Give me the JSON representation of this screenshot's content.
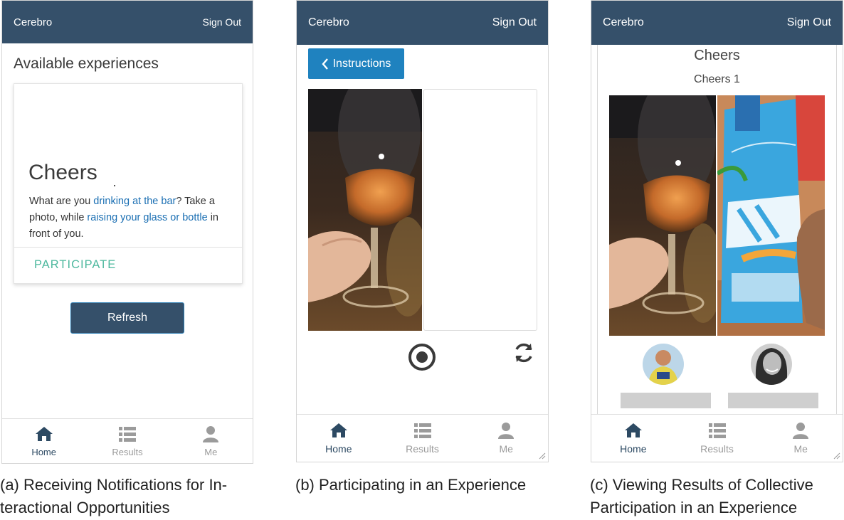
{
  "app": {
    "brand": "Cerebro",
    "sign_out": "Sign Out"
  },
  "panel_a": {
    "heading": "Available experiences",
    "card": {
      "title": "Cheers",
      "text_1": "What are you ",
      "link_1": "drinking at the bar",
      "text_2": "? Take a photo, while ",
      "link_2": "raising your glass or bottle",
      "text_3": " in front of you.",
      "action": "PARTICIPATE"
    },
    "refresh": "Refresh"
  },
  "panel_b": {
    "instructions": "Instructions"
  },
  "panel_c": {
    "title": "Cheers",
    "subtitle": "Cheers 1"
  },
  "tabs": {
    "home": "Home",
    "results": "Results",
    "me": "Me"
  },
  "captions": {
    "a": "(a) Receiving Notifications for In-teractional Opportunities",
    "b": "(b) Participating in an Experience",
    "c": "(c) Viewing Results of Collective Participation in an Experience"
  },
  "colors": {
    "topbar": "#35506a",
    "accent": "#1f82bf",
    "participate": "#4db89e",
    "link": "#1b6fb3"
  }
}
